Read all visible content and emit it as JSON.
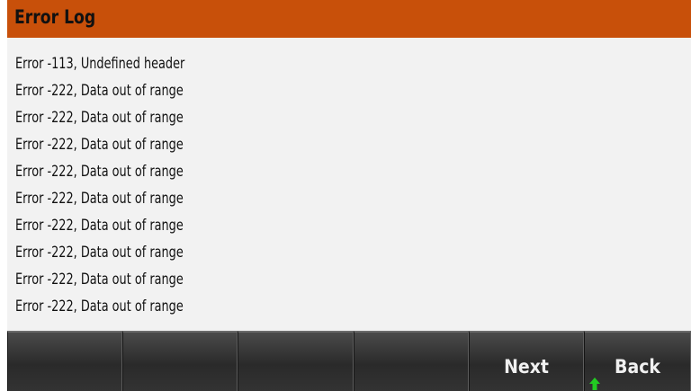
{
  "header": {
    "title": "Error Log"
  },
  "error_log": {
    "entries": [
      "Error -113, Undefined header",
      "Error -222, Data out of range",
      "Error -222, Data out of range",
      "Error -222, Data out of range",
      "Error -222, Data out of range",
      "Error -222, Data out of range",
      "Error -222, Data out of range",
      "Error -222, Data out of range",
      "Error -222, Data out of range",
      "Error -222, Data out of range"
    ]
  },
  "softkeys": {
    "keys": [
      {
        "label": ""
      },
      {
        "label": ""
      },
      {
        "label": ""
      },
      {
        "label": ""
      },
      {
        "label": "Next"
      },
      {
        "label": "Back"
      }
    ]
  },
  "colors": {
    "title_bar": "#c8500a",
    "background": "#f2f2f2",
    "softkey": "#3a3a3a",
    "back_arrow": "#22cc22"
  },
  "icons": {
    "back_arrow": "up-arrow-icon"
  }
}
